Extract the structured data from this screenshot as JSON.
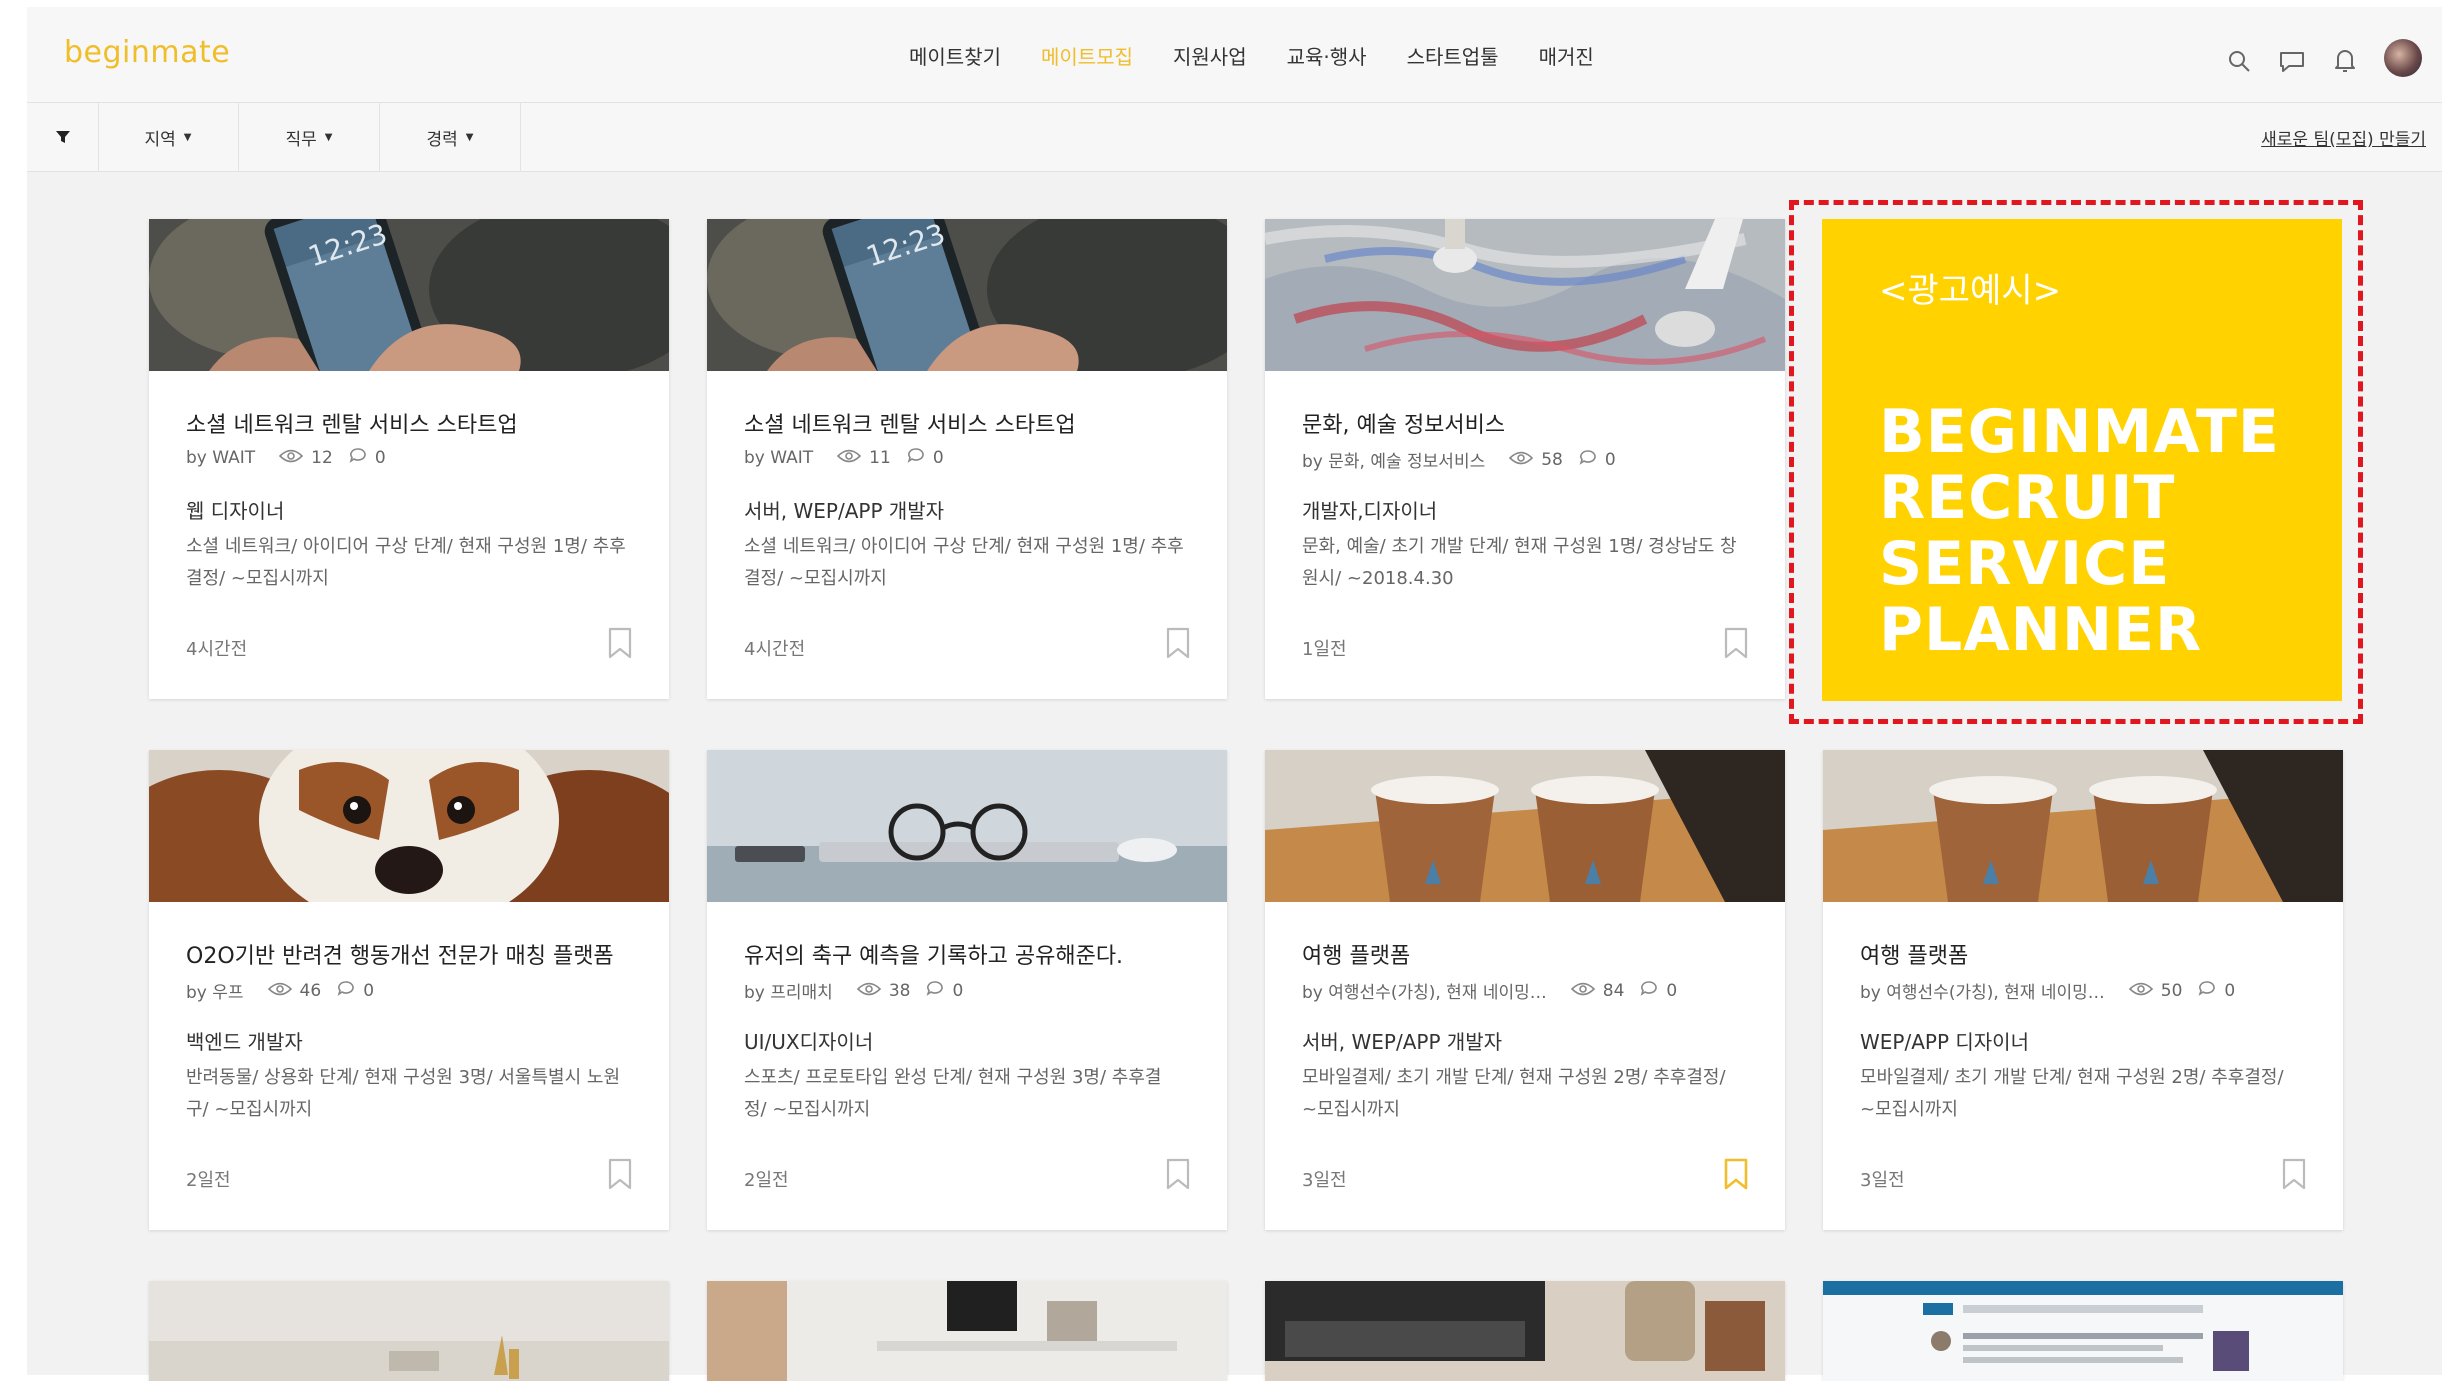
{
  "app": {
    "logo": "beginmate"
  },
  "nav": {
    "items": [
      {
        "label": "메이트찾기",
        "active": false
      },
      {
        "label": "메이트모집",
        "active": true
      },
      {
        "label": "지원사업",
        "active": false
      },
      {
        "label": "교육·행사",
        "active": false
      },
      {
        "label": "스타트업툴",
        "active": false
      },
      {
        "label": "매거진",
        "active": false
      }
    ],
    "icons": [
      "search-icon",
      "chat-icon",
      "bell-icon",
      "avatar"
    ]
  },
  "filters": {
    "region": "지역",
    "job": "직무",
    "career": "경력",
    "new_team_link": "새로운 팀(모집) 만들기"
  },
  "ad": {
    "label": "<광고예시>",
    "lines": [
      "BEGINMATE",
      "RECRUIT",
      "SERVICE",
      "PLANNER"
    ]
  },
  "cards": [
    {
      "title": "소셜 네트워크 렌탈 서비스 스타트업",
      "by": "by WAIT",
      "views": "12",
      "comments": "0",
      "role": "웹 디자이너",
      "desc": "소셜 네트워크/ 아이디어 구상 단계/ 현재 구성원 1명/ 추후결정/ ~모집시까지",
      "time": "4시간전",
      "bookmarked": false,
      "image": "phone-photo"
    },
    {
      "title": "소셜 네트워크 렌탈 서비스 스타트업",
      "by": "by WAIT",
      "views": "11",
      "comments": "0",
      "role": "서버, WEP/APP 개발자",
      "desc": "소셜 네트워크/ 아이디어 구상 단계/ 현재 구성원 1명/ 추후결정/ ~모집시까지",
      "time": "4시간전",
      "bookmarked": false,
      "image": "phone-photo"
    },
    {
      "title": "문화, 예술 정보서비스",
      "by": "by 문화, 예술 정보서비스",
      "views": "58",
      "comments": "0",
      "role": "개발자,디자이너",
      "desc": "문화, 예술/ 초기 개발 단계/ 현재 구성원 1명/ 경상남도 창원시/ ~2018.4.30",
      "time": "1일전",
      "bookmarked": false,
      "image": "paint-photo"
    },
    {
      "title": "O2O기반 반려견 행동개선 전문가 매칭 플랫폼",
      "by": "by 우프",
      "views": "46",
      "comments": "0",
      "role": "백엔드 개발자",
      "desc": "반려동물/ 상용화 단계/ 현재 구성원 3명/ 서울특별시 노원구/ ~모집시까지",
      "time": "2일전",
      "bookmarked": false,
      "image": "dog-photo"
    },
    {
      "title": "유저의 축구 예측을 기록하고 공유해준다.",
      "by": "by 프리매치",
      "views": "38",
      "comments": "0",
      "role": "UI/UX디자이너",
      "desc": "스포츠/ 프로토타입 완성 단계/ 현재 구성원 3명/ 추후결정/ ~모집시까지",
      "time": "2일전",
      "bookmarked": false,
      "image": "desk-photo"
    },
    {
      "title": "여행 플랫폼",
      "by": "by 여행선수(가칭), 현재 네이밍…",
      "views": "84",
      "comments": "0",
      "role": "서버, WEP/APP 개발자",
      "desc": "모바일결제/ 초기 개발 단계/ 현재 구성원 2명/ 추후결정/ ~모집시까지",
      "time": "3일전",
      "bookmarked": true,
      "image": "cups-photo"
    },
    {
      "title": "여행 플랫폼",
      "by": "by 여행선수(가칭), 현재 네이밍…",
      "views": "50",
      "comments": "0",
      "role": "WEP/APP 디자이너",
      "desc": "모바일결제/ 초기 개발 단계/ 현재 구성원 2명/ 추후결정/ ~모집시까지",
      "time": "3일전",
      "bookmarked": false,
      "image": "cups-photo"
    }
  ],
  "colors": {
    "accent": "#f0be2a",
    "ad_yellow": "#ffd200",
    "ad_border": "#e0171f"
  }
}
